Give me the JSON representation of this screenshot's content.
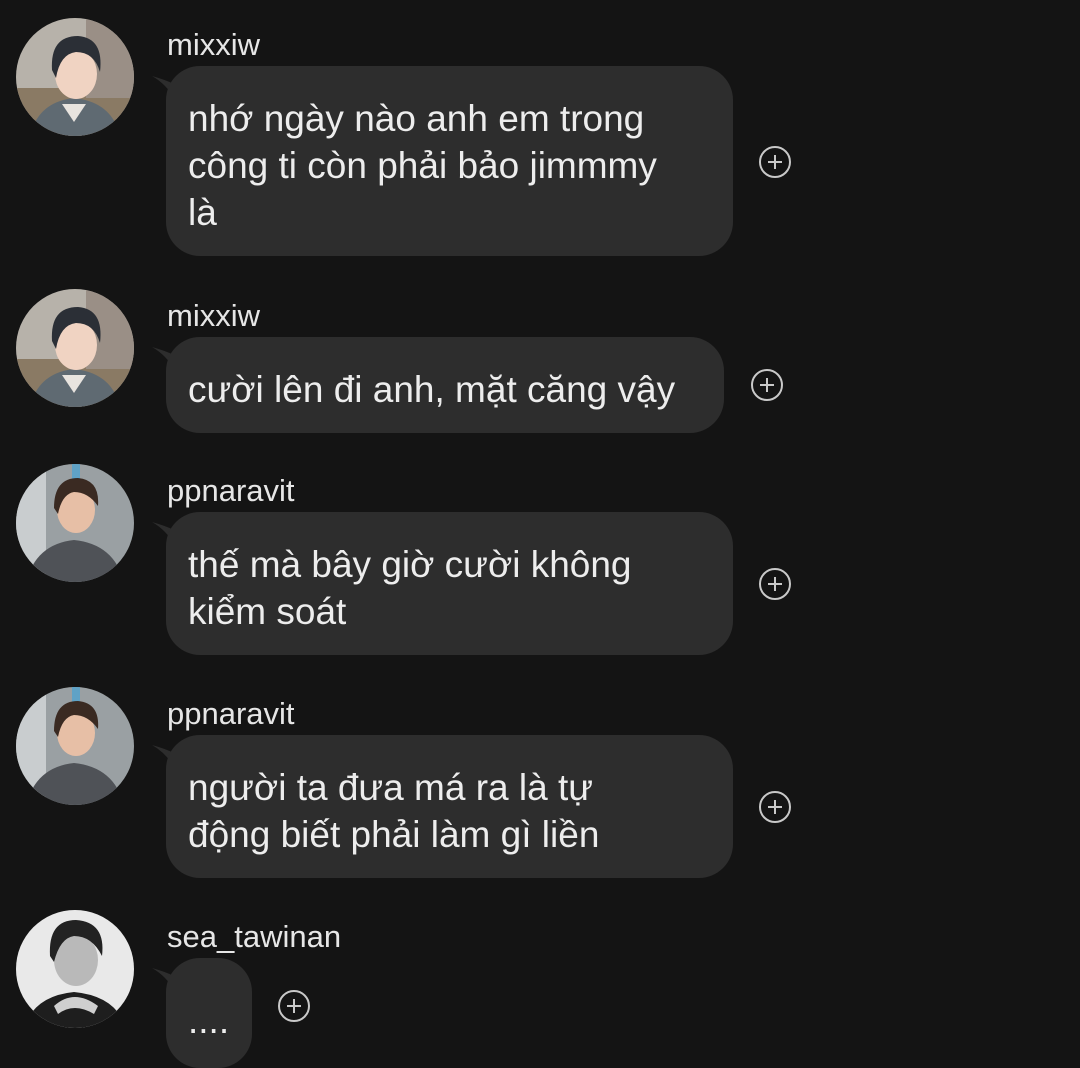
{
  "messages": [
    {
      "username": "mixxiw",
      "lines": [
        "nhớ ngày nào anh em trong",
        "công ti còn phải bảo jimmmy",
        "là"
      ],
      "avatar": "mixxiw-avatar"
    },
    {
      "username": "mixxiw",
      "lines": [
        "cười lên đi anh, mặt căng vậy"
      ],
      "avatar": "mixxiw-avatar"
    },
    {
      "username": "ppnaravit",
      "lines": [
        "thế mà bây giờ cười không",
        "kiểm soát"
      ],
      "avatar": "ppnaravit-avatar"
    },
    {
      "username": "ppnaravit",
      "lines": [
        "người ta đưa má ra là tự",
        "động biết phải làm gì liền"
      ],
      "avatar": "ppnaravit-avatar"
    },
    {
      "username": "sea_tawinan",
      "lines": [
        "...."
      ],
      "avatar": "sea_tawinan-avatar"
    }
  ],
  "icons": {
    "react": "add-reaction-icon"
  },
  "colors": {
    "background": "#141414",
    "bubble": "#2d2d2d",
    "text": "#ededed"
  }
}
